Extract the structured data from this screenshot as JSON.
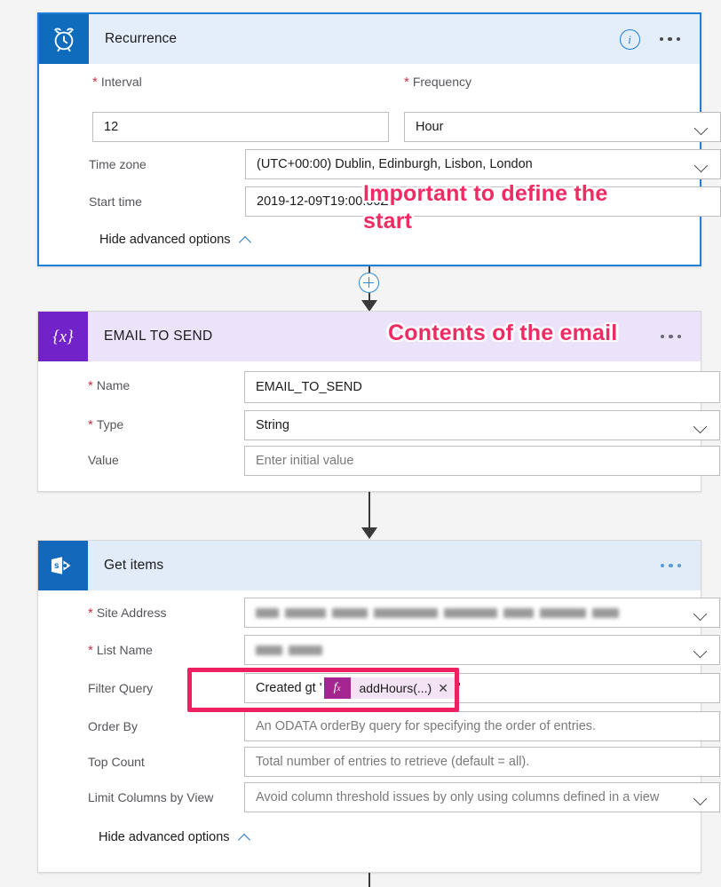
{
  "flow": {
    "recurrence": {
      "title": "Recurrence",
      "icon": "alarm-clock-icon",
      "info_icon": "info-icon",
      "menu_icon": "ellipsis-icon",
      "fields": [
        {
          "label": "Interval",
          "required": true,
          "value": "12",
          "type": "text",
          "placeholder": ""
        },
        {
          "label": "Frequency",
          "required": true,
          "value": "Hour",
          "type": "dropdown",
          "placeholder": ""
        },
        {
          "label": "Time zone",
          "required": false,
          "value": "(UTC+00:00) Dublin, Edinburgh, Lisbon, London",
          "type": "dropdown",
          "placeholder": ""
        },
        {
          "label": "Start time",
          "required": false,
          "value": "2019-12-09T19:00:00Z",
          "type": "text",
          "placeholder": ""
        }
      ],
      "advanced_toggle": "Hide advanced options"
    },
    "email_to_send": {
      "title": "EMAIL TO SEND",
      "icon": "variable-braces-icon",
      "menu_icon": "ellipsis-icon",
      "fields": [
        {
          "label": "Name",
          "required": true,
          "value": "EMAIL_TO_SEND",
          "type": "text",
          "placeholder": ""
        },
        {
          "label": "Type",
          "required": true,
          "value": "String",
          "type": "dropdown",
          "placeholder": ""
        },
        {
          "label": "Value",
          "required": false,
          "value": "",
          "type": "text",
          "placeholder": "Enter initial value"
        }
      ]
    },
    "get_items": {
      "title": "Get items",
      "icon": "sharepoint-icon",
      "menu_icon": "ellipsis-icon",
      "fields": [
        {
          "label": "Site Address",
          "required": true,
          "value": "",
          "type": "dropdown-redacted",
          "placeholder": ""
        },
        {
          "label": "List Name",
          "required": true,
          "value": "",
          "type": "dropdown-redacted",
          "placeholder": ""
        },
        {
          "label": "Order By",
          "required": false,
          "value": "",
          "type": "text",
          "placeholder": "An ODATA orderBy query for specifying the order of entries."
        },
        {
          "label": "Top Count",
          "required": false,
          "value": "",
          "type": "text",
          "placeholder": "Total number of entries to retrieve (default = all)."
        },
        {
          "label": "Limit Columns by View",
          "required": false,
          "value": "",
          "type": "dropdown",
          "placeholder": "Avoid column threshold issues by only using columns defined in a view"
        }
      ],
      "filter_query": {
        "label": "Filter Query",
        "prefix": "Created gt '",
        "token_icon": "fx-expression-icon",
        "token_label": "addHours(...)",
        "token_remove_icon": "close-icon",
        "suffix": "'"
      },
      "advanced_toggle": "Hide advanced options"
    }
  },
  "annotations": [
    {
      "text": "Important to define the\nstart",
      "name": "annotation-start-time"
    },
    {
      "text": "Contents of the email",
      "name": "annotation-email-contents"
    }
  ],
  "colors": {
    "selection_blue": "#1f7fd6",
    "recurrence_header": "#e4eefb",
    "variable_purple": "#7123c9",
    "sharepoint_blue": "#1268bb",
    "annotation_pink": "#ef2b63",
    "highlight_pink": "#ed2061",
    "expression_magenta": "#a4258f"
  }
}
